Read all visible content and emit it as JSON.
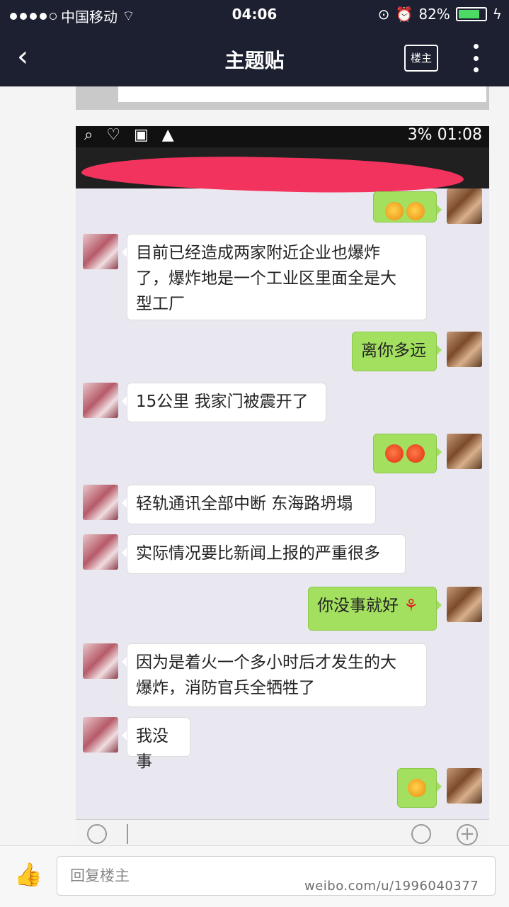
{
  "status_bar": {
    "carrier": "中国移动",
    "time": "04:06",
    "battery": "82%",
    "battery_level": 0.82
  },
  "nav": {
    "title": "主题贴",
    "owner_badge": "楼主"
  },
  "screenshot": {
    "status": {
      "time": "01:08",
      "signal": "3%"
    },
    "messages": [
      {
        "side": "out",
        "type": "emoji",
        "emoji": [
          "laugh",
          "laugh"
        ]
      },
      {
        "side": "in",
        "text": "目前已经造成两家附近企业也爆炸\n了，爆炸地是一个工业区里面全是大\n型工厂"
      },
      {
        "side": "out",
        "text": "离你多远"
      },
      {
        "side": "in",
        "text": "15公里 我家门被震开了"
      },
      {
        "side": "out",
        "type": "emoji",
        "emoji": [
          "angry",
          "angry"
        ]
      },
      {
        "side": "in",
        "text": "轻轨通讯全部中断 东海路坍塌"
      },
      {
        "side": "in",
        "text": "实际情况要比新闻上报的严重很多"
      },
      {
        "side": "out",
        "text": "你没事就好"
      },
      {
        "side": "in",
        "text": "因为是着火一个多小时后才发生的大\n爆炸，消防官兵全牺牲了"
      },
      {
        "side": "in",
        "text": "我没事"
      },
      {
        "side": "out",
        "type": "emoji",
        "emoji": [
          "laugh"
        ]
      }
    ]
  },
  "reply": {
    "placeholder": "回复楼主"
  },
  "watermark": "weibo.com/u/1996040377"
}
